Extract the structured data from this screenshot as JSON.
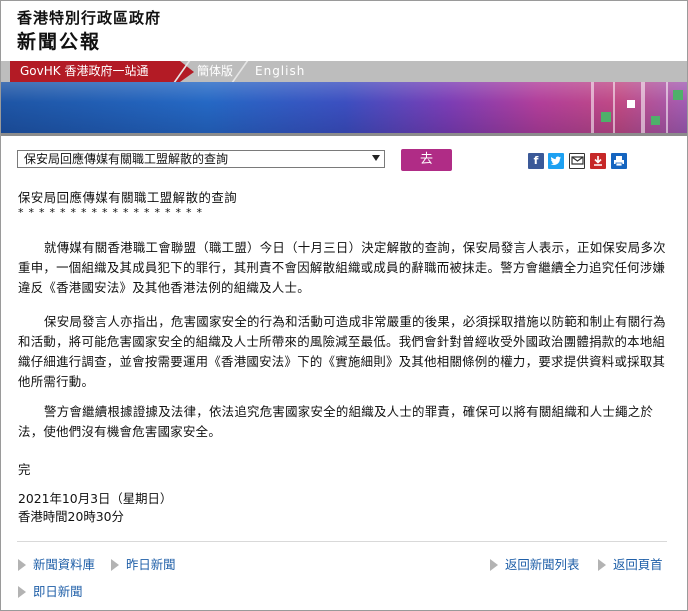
{
  "header": {
    "government_name": "香港特別行政區政府",
    "press_title": "新聞公報"
  },
  "nav": {
    "govhk": "GovHK 香港政府一站通",
    "simplified": "簡体版",
    "english": "English"
  },
  "toolbar": {
    "select_value": "保安局回應傳媒有關職工盟解散的查詢",
    "go_label": "去",
    "share_icons": [
      "facebook-icon",
      "twitter-icon",
      "email-icon",
      "download-icon",
      "print-icon"
    ]
  },
  "article": {
    "title": "保安局回應傳媒有關職工盟解散的查詢",
    "stars": "******************",
    "paragraphs": [
      "就傳媒有關香港職工會聯盟（職工盟）今日（十月三日）決定解散的查詢，保安局發言人表示，正如保安局多次重申，一個組織及其成員犯下的罪行，其刑責不會因解散組織或成員的辭職而被抹走。警方會繼續全力追究任何涉嫌違反《香港國安法》及其他香港法例的組織及人士。",
      "保安局發言人亦指出，危害國家安全的行為和活動可造成非常嚴重的後果，必須採取措施以防範和制止有關行為和活動，將可能危害國家安全的組織及人士所帶來的風險減至最低。我們會針對曾經收受外國政治團體捐款的本地組織仔細進行調查，並會按需要運用《香港國安法》下的《實施細則》及其他相關條例的權力，要求提供資料或採取其他所需行動。",
      "警方會繼續根據證據及法律，依法追究危害國家安全的組織及人士的罪責，確保可以將有關組織和人士繩之於法，使他們沒有機會危害國家安全。"
    ],
    "end": "完",
    "date": "2021年10月3日（星期日）",
    "time": "香港時間20時30分"
  },
  "footer": {
    "press_archive": "新聞資料庫",
    "yesterday": "昨日新聞",
    "back_list": "返回新聞列表",
    "back_top": "返回頁首",
    "today": "即日新聞"
  },
  "colors": {
    "govhk_red": "#b31b25",
    "go_button": "#b02c86",
    "link_blue": "#1f5fa8"
  }
}
